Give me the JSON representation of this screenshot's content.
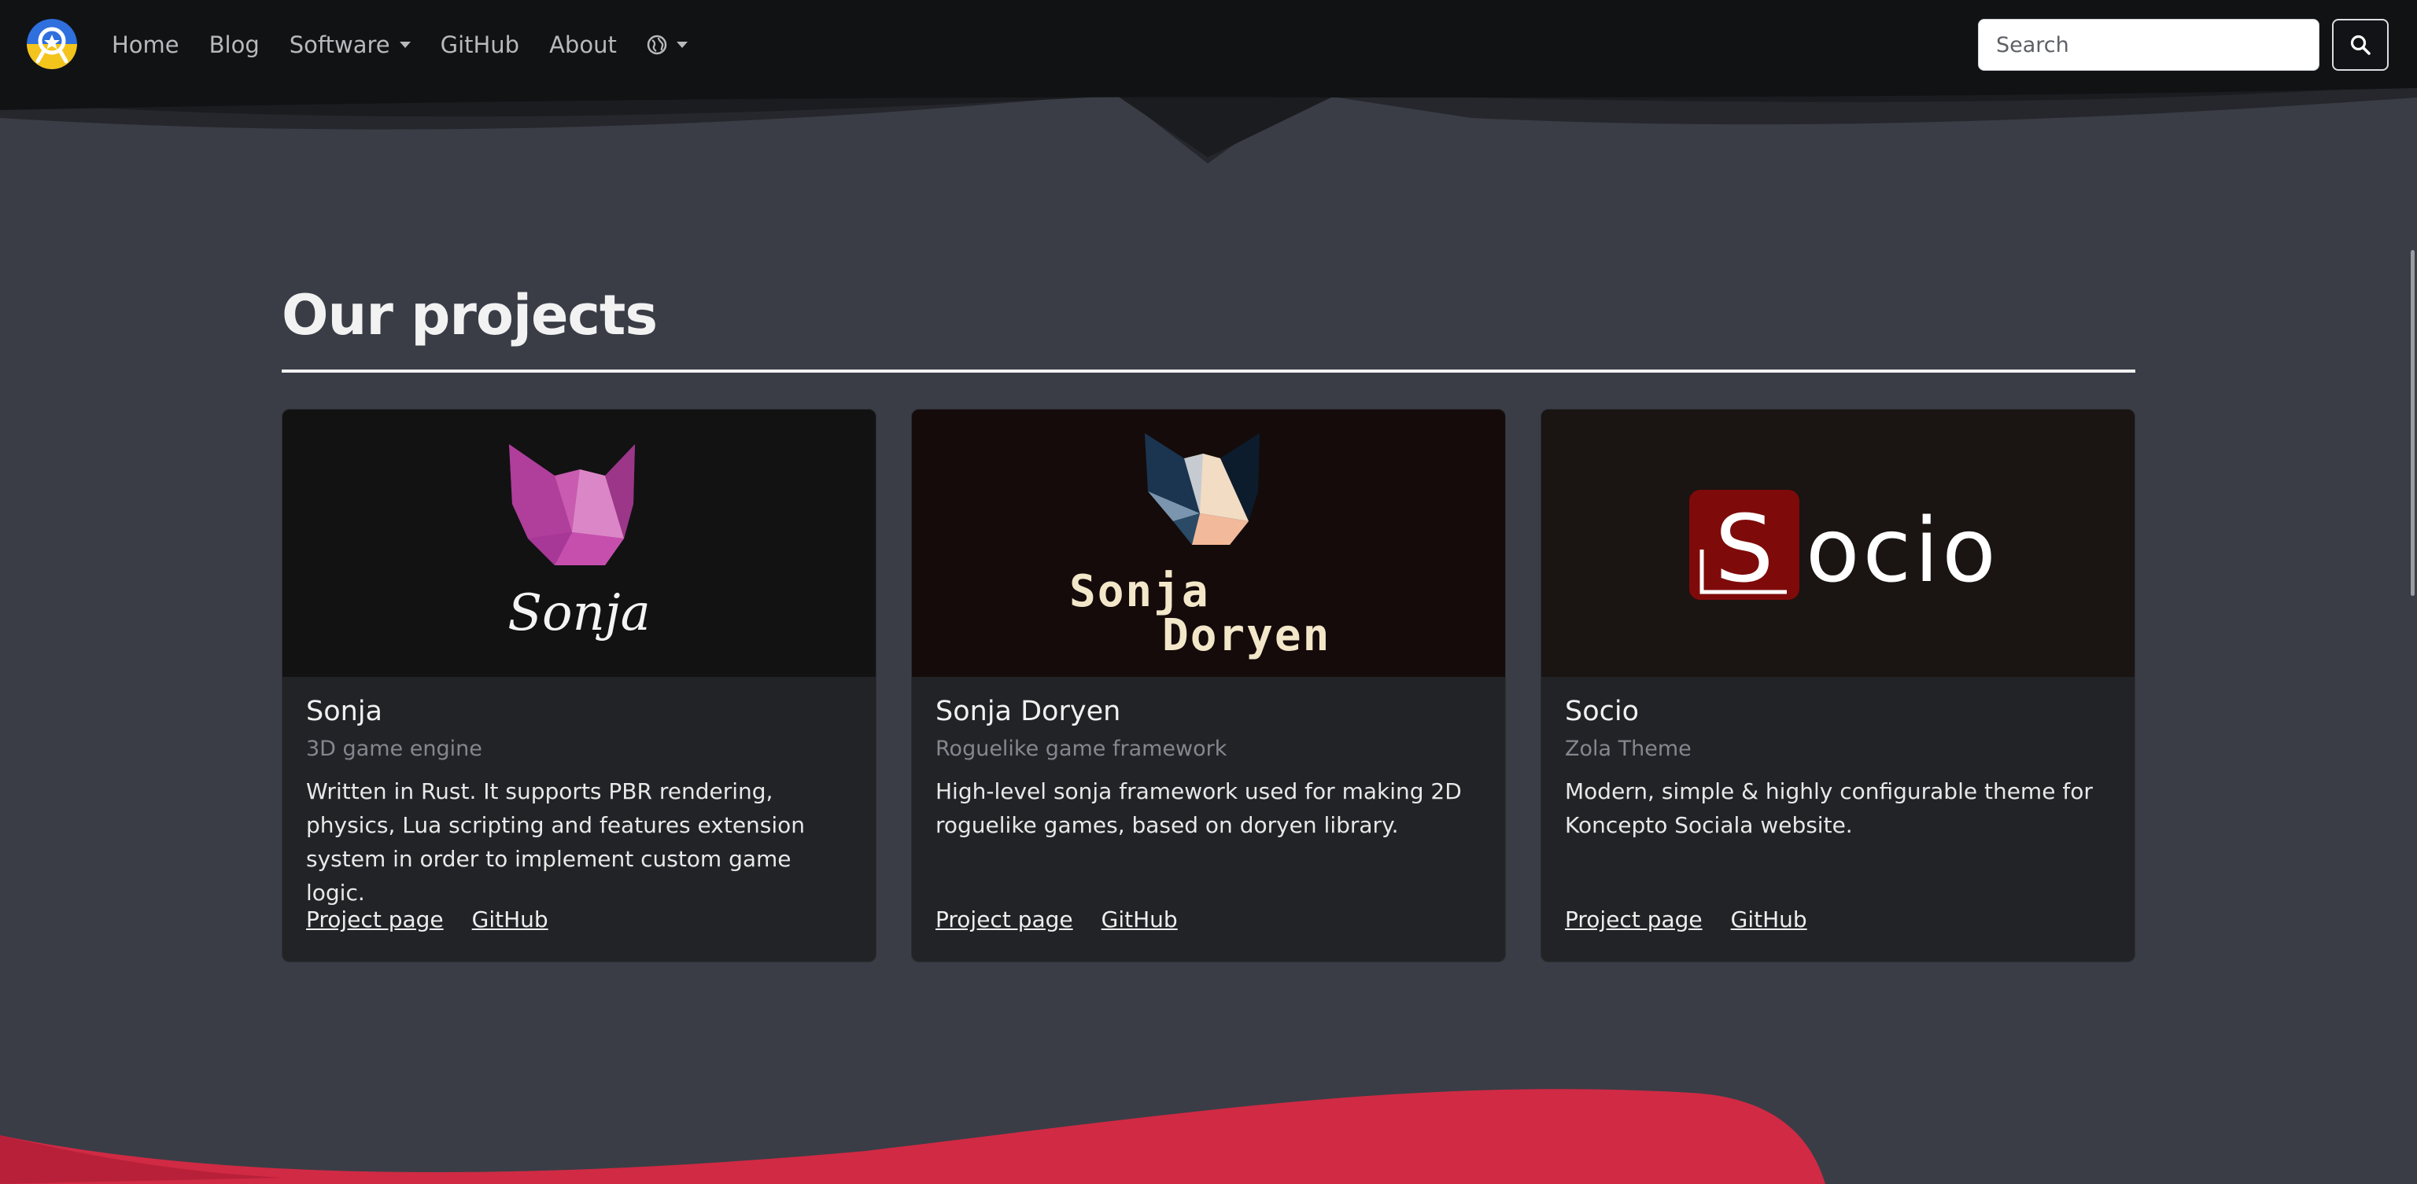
{
  "navbar": {
    "logo_icon": "koncepto-sociala-logo",
    "links": {
      "home": "Home",
      "blog": "Blog",
      "software": "Software",
      "github": "GitHub",
      "about": "About"
    },
    "language_icon": "globe-icon",
    "search": {
      "placeholder": "Search",
      "button_icon": "search-icon"
    }
  },
  "main": {
    "title": "Our projects",
    "cards": [
      {
        "title": "Sonja",
        "subtitle": "3D game engine",
        "text": "Written in Rust. It supports PBR rendering, physics, Lua scripting and features extension system in order to implement custom game logic.",
        "image_label": "Sonja",
        "links": {
          "project": "Project page",
          "github": "GitHub"
        }
      },
      {
        "title": "Sonja Doryen",
        "subtitle": "Roguelike game framework",
        "text": "High-level sonja framework used for making 2D roguelike games, based on doryen library.",
        "image_label_line1": "Sonja",
        "image_label_line2": "Doryen",
        "links": {
          "project": "Project page",
          "github": "GitHub"
        }
      },
      {
        "title": "Socio",
        "subtitle": "Zola Theme",
        "text": "Modern, simple & highly configurable theme for Koncepto Sociala website.",
        "image_label_letter": "S",
        "image_label_rest": "ocio",
        "links": {
          "project": "Project page",
          "github": "GitHub"
        }
      }
    ]
  },
  "colors": {
    "background": "#3a3d46",
    "navbar": "#111214",
    "card": "#222327",
    "accent_red": "#d12a44",
    "sonja_pink": "#c449a9",
    "socio_red": "#7f0a0a"
  }
}
